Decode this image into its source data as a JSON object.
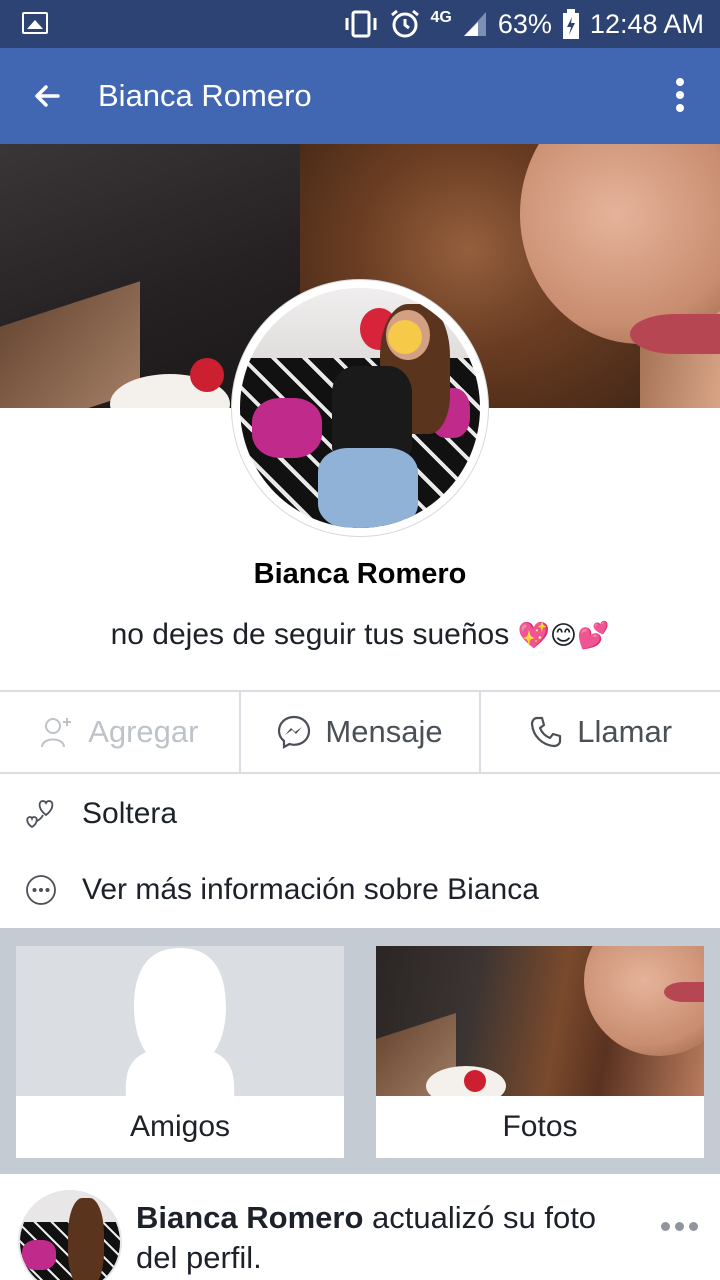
{
  "status_bar": {
    "battery": "63%",
    "network": "4G",
    "time": "12:48 AM"
  },
  "app_bar": {
    "title": "Bianca Romero"
  },
  "profile": {
    "name": "Bianca Romero",
    "bio": "no dejes de seguir tus sueños",
    "bio_emojis": "💖😊💕"
  },
  "actions": {
    "add_label": "Agregar",
    "message_label": "Mensaje",
    "call_label": "Llamar"
  },
  "info": {
    "relationship": "Soltera",
    "more_info": "Ver más información sobre Bianca"
  },
  "tiles": {
    "friends_label": "Amigos",
    "photos_label": "Fotos"
  },
  "post": {
    "author": "Bianca Romero",
    "action_text": " actualizó su foto del perfil."
  },
  "colors": {
    "status_bar": "#2d4373",
    "app_bar": "#4267b2",
    "divider": "#dadde1",
    "tiles_bg": "#c5cbd3"
  }
}
